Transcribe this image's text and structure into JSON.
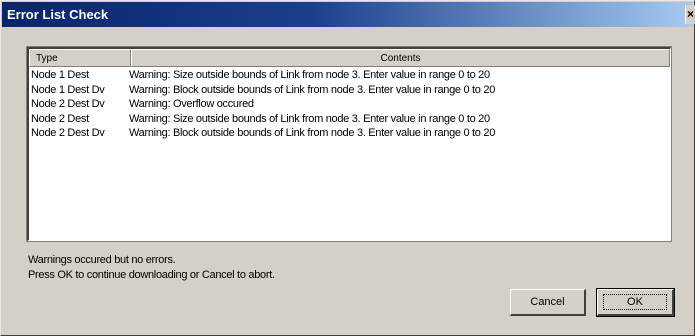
{
  "window": {
    "title": "Error List Check",
    "close_glyph": "×"
  },
  "list": {
    "columns": [
      "Type",
      "Contents"
    ],
    "rows": [
      {
        "type": "Node 1 Dest",
        "contents": "Warning: Size outside bounds of Link from node 3. Enter value in  range 0 to 20"
      },
      {
        "type": "Node 1 Dest Dv",
        "contents": "Warning: Block outside bounds of Link from node 3. Enter value in  range 0 to 20"
      },
      {
        "type": "Node 2 Dest Dv",
        "contents": "Warning: Overflow occured"
      },
      {
        "type": "Node 2 Dest",
        "contents": "Warning: Size outside bounds of Link from node 3. Enter value in  range 0 to 20"
      },
      {
        "type": "Node 2 Dest Dv",
        "contents": "Warning: Block outside bounds of Link from node 3. Enter value in  range 0 to 20"
      }
    ]
  },
  "status": {
    "line1": "Warnings occured but no errors.",
    "line2": "Press OK to continue downloading or Cancel to abort."
  },
  "buttons": {
    "cancel": "Cancel",
    "ok": "OK"
  }
}
